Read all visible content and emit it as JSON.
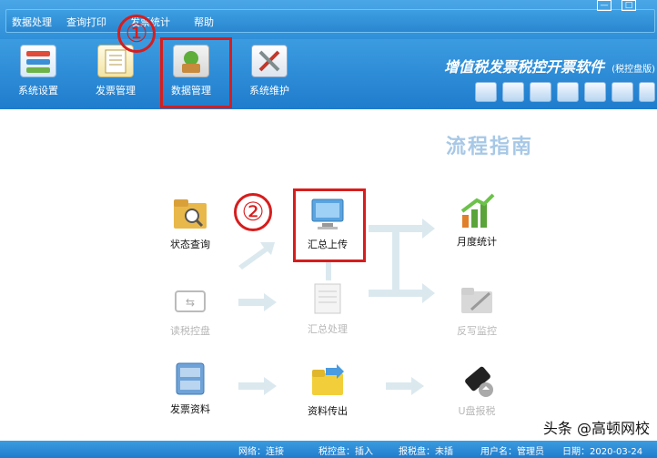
{
  "menu": {
    "items": [
      "数据处理",
      "查询打印",
      "发票统计",
      "帮助"
    ]
  },
  "toolbar": {
    "tools": [
      {
        "label": "系统设置",
        "icon": "system-settings-icon"
      },
      {
        "label": "发票管理",
        "icon": "invoice-management-icon"
      },
      {
        "label": "数据管理",
        "icon": "data-management-icon"
      },
      {
        "label": "系统维护",
        "icon": "system-maintenance-icon"
      }
    ],
    "app_title": "增值税发票税控开票软件",
    "app_subtitle": "(税控盘版)"
  },
  "guide": {
    "title": "流程指南",
    "steps": [
      {
        "label": "状态查询"
      },
      {
        "label": "汇总上传"
      },
      {
        "label": "月度统计"
      },
      {
        "label": "读税控盘"
      },
      {
        "label": "汇总处理"
      },
      {
        "label": "反写监控"
      },
      {
        "label": "发票资料"
      },
      {
        "label": "资料传出"
      },
      {
        "label": "U盘报税"
      }
    ]
  },
  "annotations": {
    "circle1": "①",
    "circle2": "②"
  },
  "status": {
    "network": "网络：连接",
    "taxdisk": "税控盘：插入",
    "reportdisk": "报税盘：未插",
    "user": "用户名：管理员",
    "date": "日期：2020-03-24"
  },
  "watermark": "头条 @高顿网校",
  "colors": {
    "chrome_blue": "#2f8fd8",
    "annotation_red": "#d71d1d",
    "guide_title": "#a7c8e6"
  }
}
